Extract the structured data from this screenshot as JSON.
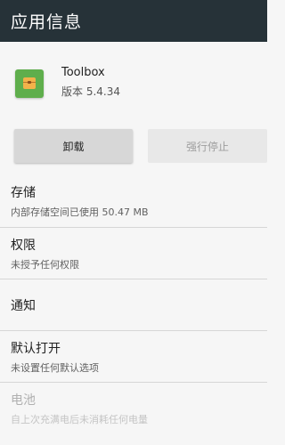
{
  "appbar": {
    "title": "应用信息"
  },
  "app": {
    "name": "Toolbox",
    "version": "版本 5.4.34"
  },
  "buttons": {
    "uninstall": "卸载",
    "force_stop": "强行停止"
  },
  "items": [
    {
      "title": "存储",
      "subtitle": "内部存储空间已使用 50.47 MB"
    },
    {
      "title": "权限",
      "subtitle": "未授予任何权限"
    },
    {
      "title": "通知",
      "subtitle": ""
    },
    {
      "title": "默认打开",
      "subtitle": "未设置任何默认选项"
    },
    {
      "title": "电池",
      "subtitle": "自上次充满电后未消耗任何电量"
    }
  ]
}
